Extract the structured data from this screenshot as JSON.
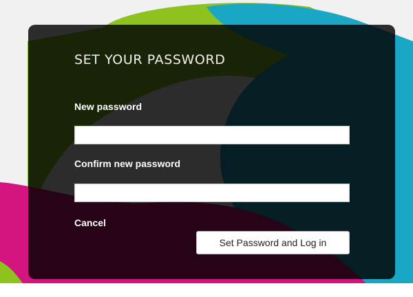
{
  "dialog": {
    "title": "SET YOUR PASSWORD",
    "new_password": {
      "label": "New password",
      "value": "",
      "placeholder": ""
    },
    "confirm_password": {
      "label": "Confirm new password",
      "value": "",
      "placeholder": ""
    },
    "cancel_label": "Cancel",
    "submit_label": "Set Password and Log in"
  },
  "colors": {
    "background": "#f1f1f1",
    "green": "#8dc21f",
    "teal": "#1aa7c4",
    "magenta": "#d4147f",
    "dialog_overlay": "#000000"
  }
}
